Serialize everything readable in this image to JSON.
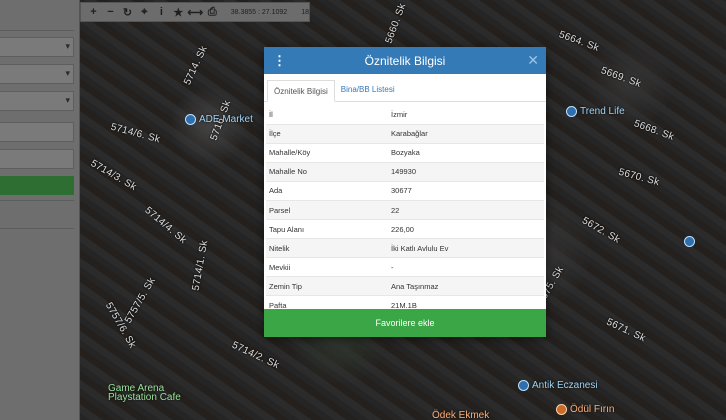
{
  "toolbar": {
    "coords": "38.3855 : 27.1092",
    "zoom": "18"
  },
  "map": {
    "streets": [
      "5660. Sk",
      "5664. Sk",
      "5714. Sk",
      "5714/6. Sk",
      "5716. Sk",
      "5714/3. Sk",
      "5714/4. Sk",
      "5669. Sk",
      "5668. Sk",
      "5670. Sk",
      "5672. Sk",
      "5675. Sk",
      "5671. Sk",
      "5714/2. Sk",
      "5757/6. Sk",
      "5757/5. Sk",
      "5714/1. Sk"
    ],
    "pois": [
      "ADE Market",
      "Trend Life",
      "Game Arena Playstation Cafe",
      "Antik Eczanesi",
      "Ödül Fırın",
      "Ödek Ekmek"
    ]
  },
  "dialog": {
    "title": "Öznitelik Bilgisi",
    "tabs": [
      "Öznitelik Bilgisi",
      "Bina/BB Listesi"
    ],
    "rows": [
      {
        "key": "İl",
        "value": "İzmir"
      },
      {
        "key": "İlçe",
        "value": "Karabağlar"
      },
      {
        "key": "Mahalle/Köy",
        "value": "Bozyaka"
      },
      {
        "key": "Mahalle No",
        "value": "149930"
      },
      {
        "key": "Ada",
        "value": "30677"
      },
      {
        "key": "Parsel",
        "value": "22"
      },
      {
        "key": "Tapu Alanı",
        "value": "226,00"
      },
      {
        "key": "Nitelik",
        "value": "İki Katlı Avlulu Ev"
      },
      {
        "key": "Mevkii",
        "value": "-"
      },
      {
        "key": "Zemin Tip",
        "value": "Ana Taşınmaz"
      },
      {
        "key": "Pafta",
        "value": "21M.1B"
      }
    ],
    "favorite_button": "Favorilere ekle"
  },
  "colors": {
    "header": "#337ab7",
    "favorite": "#3aa646"
  }
}
